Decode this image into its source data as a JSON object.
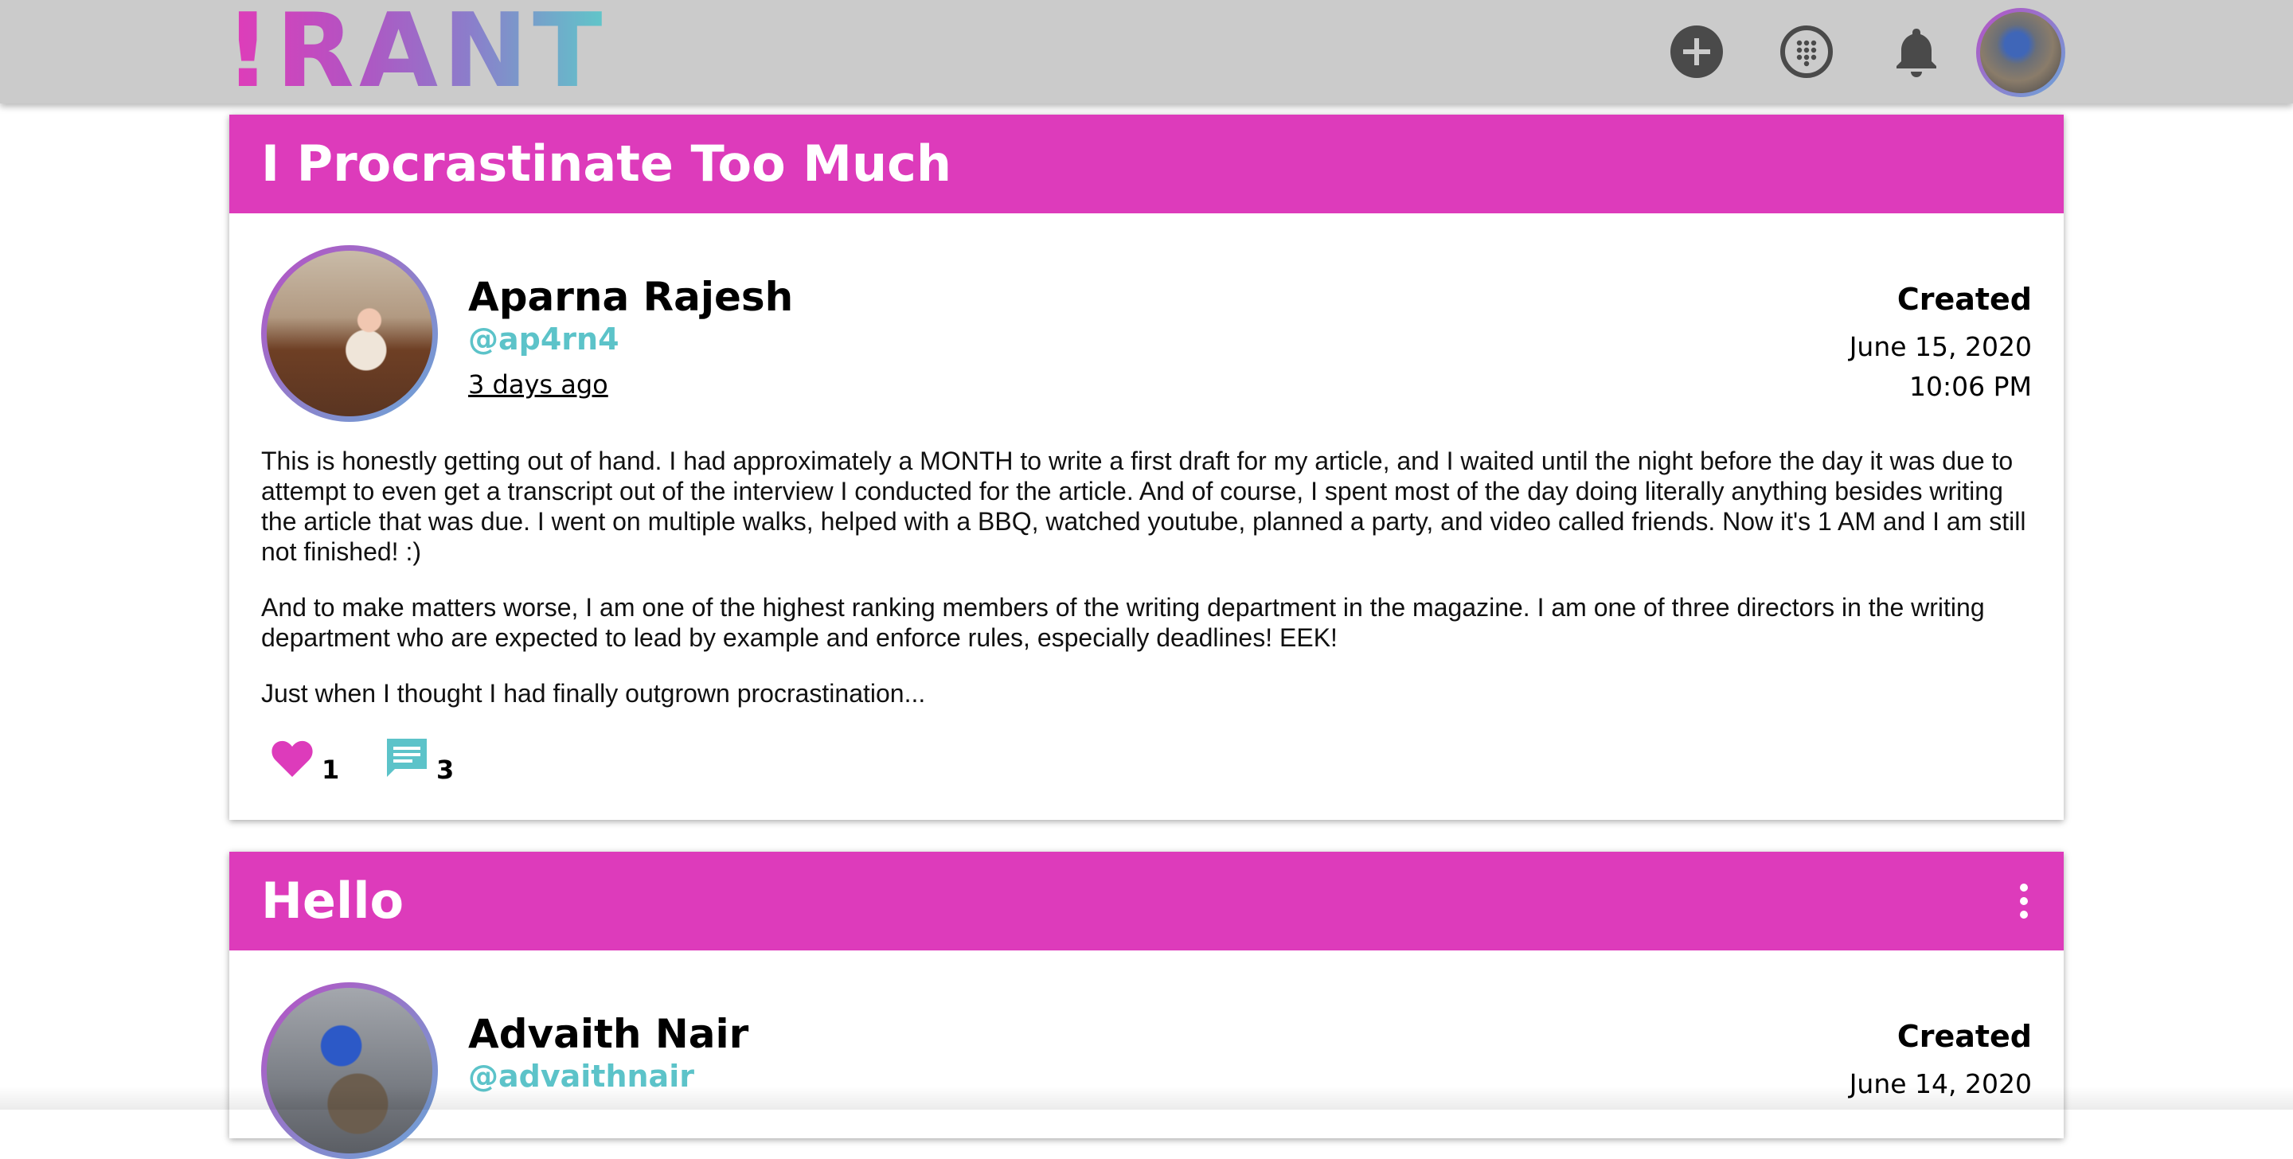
{
  "app": {
    "logo_text": "!RANT",
    "nav_icons": [
      "plus-circle-icon",
      "dialpad-icon",
      "bell-icon"
    ],
    "accent_color": "#dd3bbb",
    "handle_color": "#5cc3c9"
  },
  "posts": [
    {
      "title": "I Procrastinate Too Much",
      "author_name": "Aparna Rajesh",
      "author_handle": "@ap4rn4",
      "relative_time": "3 days ago",
      "created_label": "Created",
      "created_date": "June 15, 2020",
      "created_time": "10:06 PM",
      "paragraphs": [
        "This is honestly getting out of hand. I had approximately a MONTH to write a first draft for my article, and I waited until the night before the day it was due to attempt to even get a transcript out of the interview I conducted for the article. And of course, I spent most of the day doing literally anything besides writing the article that was due. I went on multiple walks, helped with a BBQ, watched youtube, planned a party, and video called friends. Now it's 1 AM and I am still not finished! :)",
        "And to make matters worse, I am one of the highest ranking members of the writing department in the magazine. I am one of three directors in the writing department who are expected to lead by example and enforce rules, especially deadlines! EEK!",
        "Just when I thought I had finally outgrown procrastination..."
      ],
      "likes": "1",
      "comments": "3"
    },
    {
      "title": "Hello",
      "author_name": "Advaith Nair",
      "author_handle": "@advaithnair",
      "created_label": "Created",
      "created_date": "June 14, 2020"
    }
  ]
}
